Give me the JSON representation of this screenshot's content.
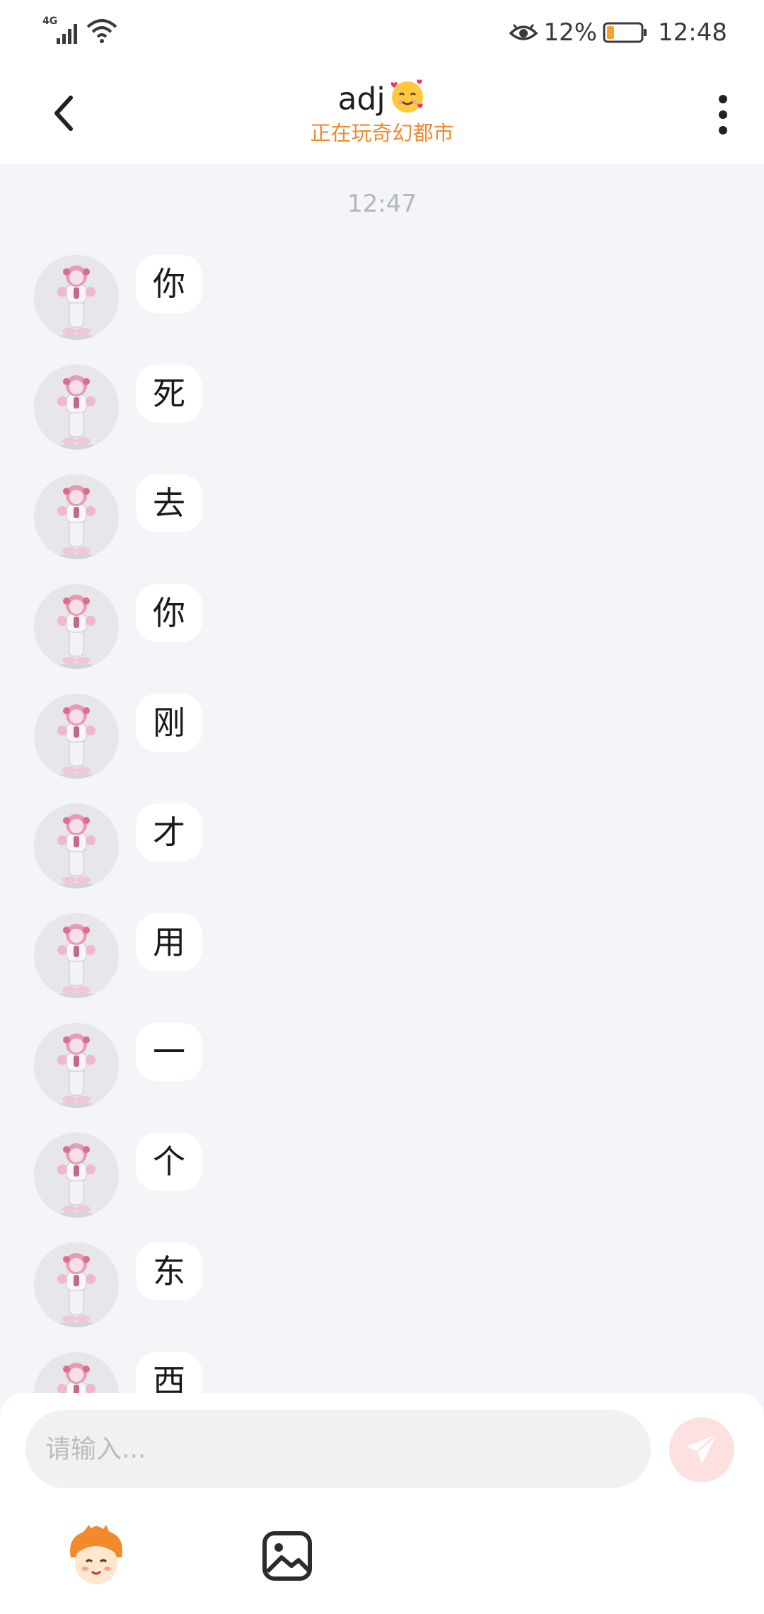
{
  "status_bar": {
    "network": "4G",
    "battery_percent": "12%",
    "battery_level": 0.12,
    "time": "12:48",
    "icons": [
      "signal-icon",
      "wifi-icon",
      "eye-icon",
      "battery-icon"
    ]
  },
  "header": {
    "title": "adj",
    "title_emoji": "smiling-face-with-hearts",
    "subtitle": "正在玩奇幻都市",
    "subtitle_color": "#ef8a2e"
  },
  "conversation": {
    "timestamp": "12:47",
    "messages": [
      {
        "text": "你"
      },
      {
        "text": "死"
      },
      {
        "text": "去"
      },
      {
        "text": "你"
      },
      {
        "text": "刚"
      },
      {
        "text": "才"
      },
      {
        "text": "用"
      },
      {
        "text": "一"
      },
      {
        "text": "个"
      },
      {
        "text": "东"
      },
      {
        "text": "西"
      }
    ]
  },
  "composer": {
    "placeholder": "请输入...",
    "send_icon": "paper-plane-icon",
    "send_color": "#fde0e0",
    "tools": [
      "mascot-sticker-icon",
      "image-icon"
    ]
  },
  "colors": {
    "chat_background": "#f3f5f8",
    "bubble": "#ffffff"
  }
}
